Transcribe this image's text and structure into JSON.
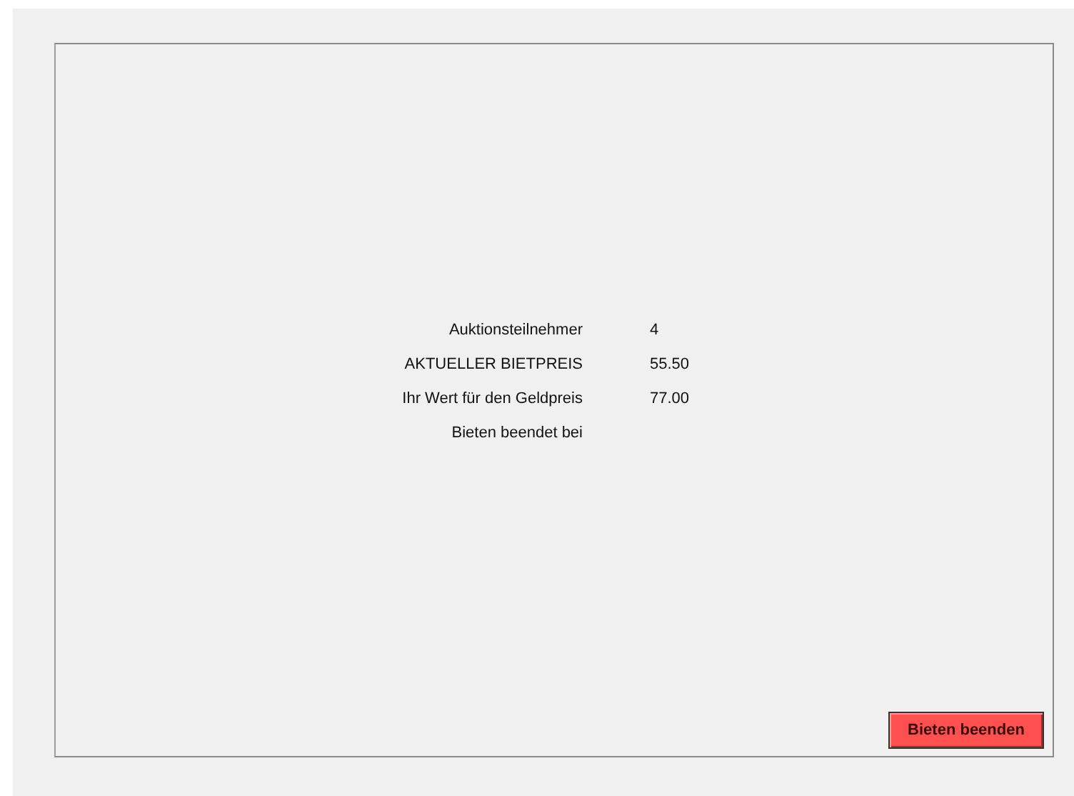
{
  "fields": [
    {
      "label": "Auktionsteilnehmer",
      "value": "4"
    },
    {
      "label": "AKTUELLER BIETPREIS",
      "value": "55.50"
    },
    {
      "label": "Ihr Wert für den Geldpreis",
      "value": "77.00"
    },
    {
      "label": "Bieten beendet bei"
    }
  ],
  "button": {
    "label": "Bieten beenden"
  }
}
